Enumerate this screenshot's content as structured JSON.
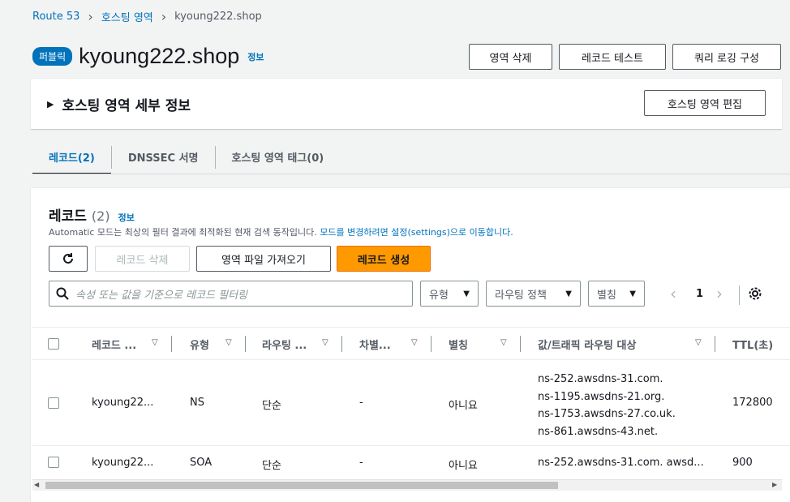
{
  "breadcrumb": {
    "items": [
      "Route 53",
      "호스팅 영역",
      "kyoung222.shop"
    ]
  },
  "header": {
    "badge": "퍼블릭",
    "title": "kyoung222.shop",
    "info": "정보",
    "buttons": {
      "delete_zone": "영역 삭제",
      "test_record": "레코드 테스트",
      "query_logging": "쿼리 로깅 구성"
    }
  },
  "details": {
    "title": "호스팅 영역 세부 정보",
    "edit_button": "호스팅 영역 편집"
  },
  "tabs": [
    {
      "label": "레코드(2)",
      "active": true
    },
    {
      "label": "DNSSEC 서명",
      "active": false
    },
    {
      "label": "호스팅 영역 태그(0)",
      "active": false
    }
  ],
  "records": {
    "title": "레코드",
    "count": "(2)",
    "info": "정보",
    "description": "Automatic 모드는 최상의 필터 결과에 최적화된 현재 검색 동작입니다.",
    "description_link": "모드를 변경하려면 설정(settings)으로 이동합니다.",
    "buttons": {
      "delete": "레코드 삭제",
      "import": "영역 파일 가져오기",
      "create": "레코드 생성"
    },
    "search_placeholder": "속성 또는 값을 기준으로 레코드 필터링",
    "filters": {
      "type": "유형",
      "routing": "라우팅 정책",
      "alias": "별칭"
    },
    "page": "1",
    "columns": [
      "레코드 ...",
      "유형",
      "라우팅 ...",
      "차별...",
      "별칭",
      "값/트래픽 라우팅 대상",
      "TTL(초)"
    ],
    "rows": [
      {
        "name": "kyoung22...",
        "type": "NS",
        "routing": "단순",
        "diff": "-",
        "alias": "아니요",
        "values": [
          "ns-252.awsdns-31.com.",
          "ns-1195.awsdns-21.org.",
          "ns-1753.awsdns-27.co.uk.",
          "ns-861.awsdns-43.net."
        ],
        "ttl": "172800"
      },
      {
        "name": "kyoung22...",
        "type": "SOA",
        "routing": "단순",
        "diff": "-",
        "alias": "아니요",
        "values": [
          "ns-252.awsdns-31.com. awsd..."
        ],
        "ttl": "900"
      }
    ]
  },
  "colors": {
    "link": "#0073bb",
    "primary": "#ff9900",
    "badge": "#0073bb"
  },
  "icons": [
    "chevron-right-icon",
    "caret-right-icon",
    "refresh-icon",
    "search-icon",
    "caret-down-icon",
    "sort-icon",
    "gear-icon",
    "chevron-left-icon"
  ]
}
